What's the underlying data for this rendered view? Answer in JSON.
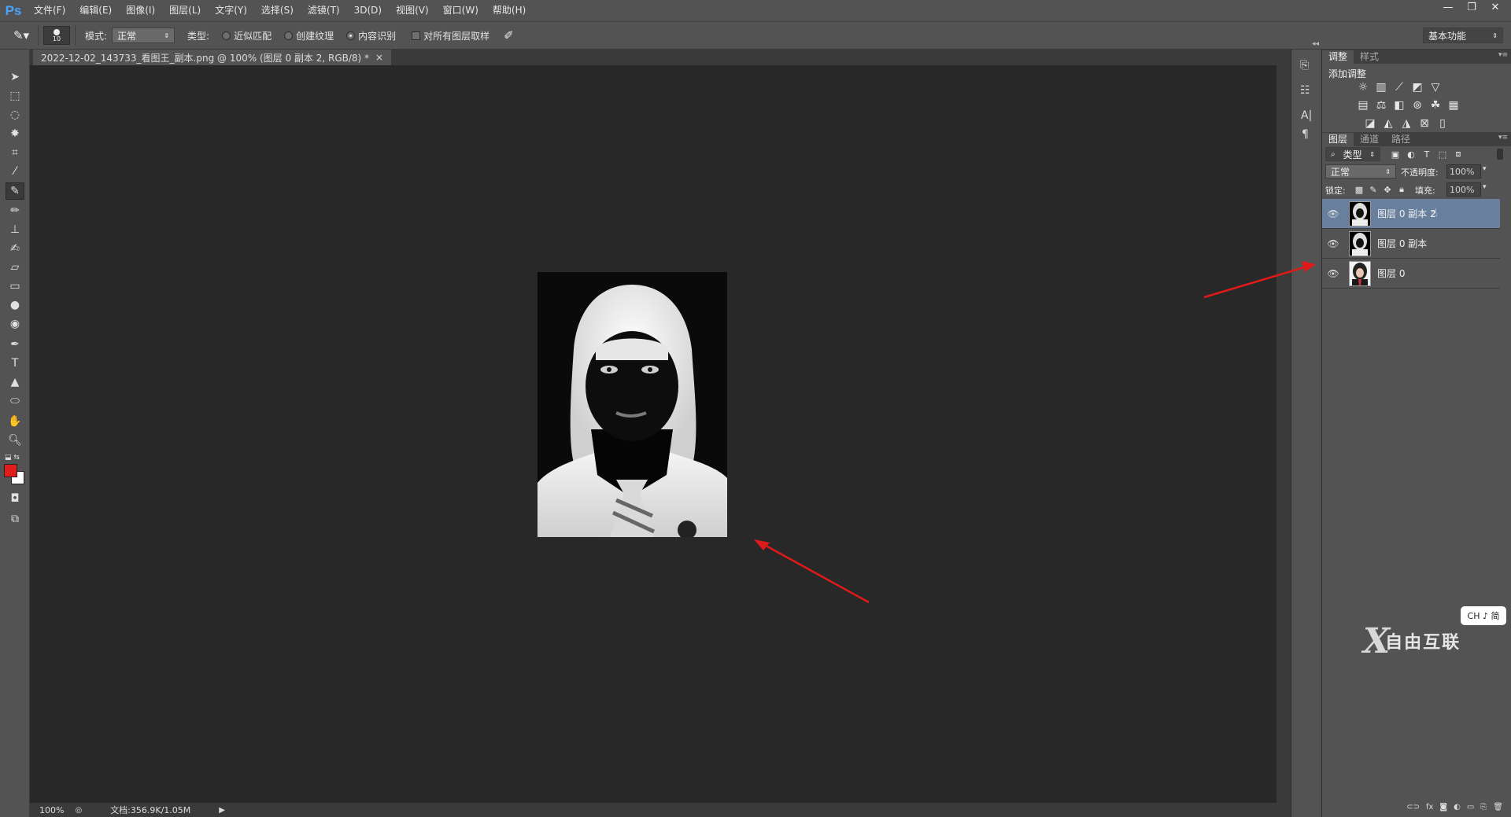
{
  "app": {
    "logo": "Ps"
  },
  "menu": [
    "文件(F)",
    "编辑(E)",
    "图像(I)",
    "图层(L)",
    "文字(Y)",
    "选择(S)",
    "滤镜(T)",
    "3D(D)",
    "视图(V)",
    "窗口(W)",
    "帮助(H)"
  ],
  "window_controls": {
    "minimize": "—",
    "restore": "❐",
    "close": "✕"
  },
  "options": {
    "brush_size": "10",
    "mode_label": "模式:",
    "mode_value": "正常",
    "type_label": "类型:",
    "radio_1": "近似匹配",
    "radio_2": "创建纹理",
    "radio_3": "内容识别",
    "checkbox_label": "对所有图层取样",
    "workspace": "基本功能"
  },
  "document": {
    "tab_title": "2022-12-02_143733_看图王_副本.png @ 100% (图层 0 副本 2, RGB/8) *",
    "tab_close": "×"
  },
  "status": {
    "zoom": "100%",
    "doc_info": "文档:356.9K/1.05M"
  },
  "adjustments": {
    "tab_adjust": "调整",
    "tab_styles": "样式",
    "heading": "添加调整"
  },
  "layers_panel": {
    "tab_layers": "图层",
    "tab_channels": "通道",
    "tab_paths": "路径",
    "filter_kind": "类型",
    "blend_mode": "正常",
    "opacity_label": "不透明度:",
    "opacity_value": "100%",
    "lock_label": "锁定:",
    "fill_label": "填充:",
    "fill_value": "100%",
    "layers": [
      {
        "name": "图层 0 副本 2"
      },
      {
        "name": "图层 0 副本"
      },
      {
        "name": "图层 0"
      }
    ]
  },
  "ime_badge": "CH ♪ 简",
  "watermark": "自由互联",
  "colors": {
    "foreground": "#e21d1d",
    "background": "#ffffff",
    "arrow": "#e01a1a",
    "selected_layer": "#68809e"
  }
}
